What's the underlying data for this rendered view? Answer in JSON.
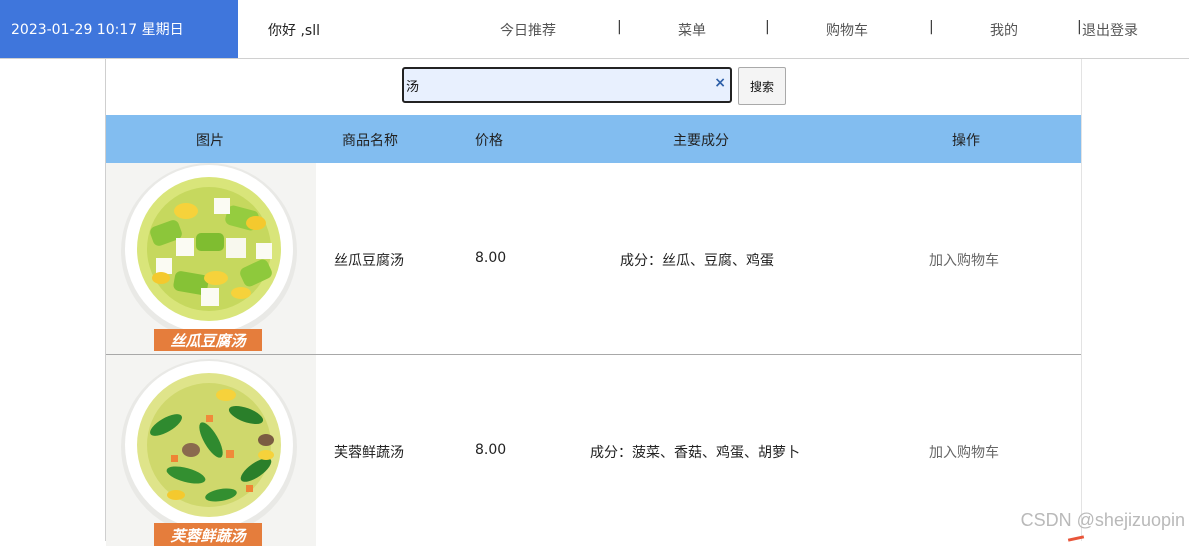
{
  "header": {
    "datetime": "2023-01-29 10:17 星期日",
    "greeting": "你好 ,sll",
    "nav": [
      "今日推荐",
      "菜单",
      "购物车",
      "我的",
      "退出登录"
    ],
    "separator": "|"
  },
  "search": {
    "value": "汤",
    "clear_symbol": "×",
    "button_label": "搜索"
  },
  "table": {
    "columns": [
      "图片",
      "商品名称",
      "价格",
      "主要成分",
      "操作"
    ],
    "rows": [
      {
        "caption": "丝瓜豆腐汤",
        "name": "丝瓜豆腐汤",
        "price": "8.00",
        "ingredients": "成分：丝瓜、豆腐、鸡蛋",
        "action": "加入购物车"
      },
      {
        "caption": "芙蓉鲜蔬汤",
        "name": "芙蓉鲜蔬汤",
        "price": "8.00",
        "ingredients": "成分：菠菜、香菇、鸡蛋、胡萝卜",
        "action": "加入购物车"
      }
    ]
  },
  "watermark": "CSDN @shejizuopin",
  "colors": {
    "date_bg": "#3f76dc",
    "table_header_bg": "#82bdf0",
    "search_bg": "#e8f0fe",
    "caption_bg": "#e57d3c"
  },
  "icons": {
    "clear": "close-icon"
  }
}
